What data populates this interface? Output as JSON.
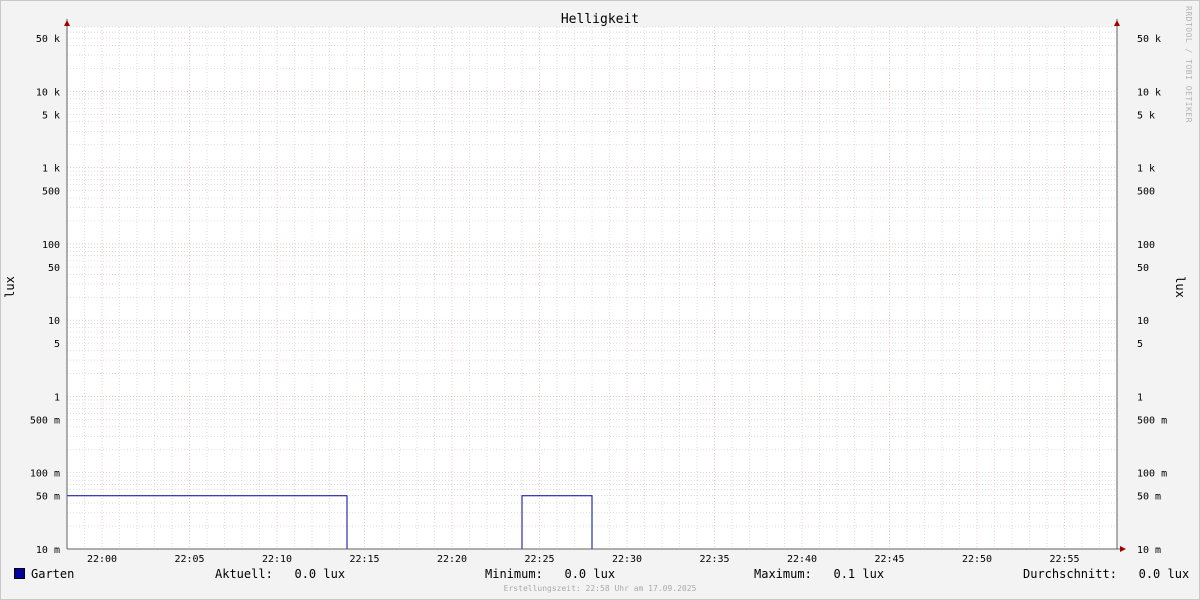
{
  "chart_data": {
    "type": "line",
    "title": "Helligkeit",
    "ylabel_left": "lux",
    "ylabel_right": "lux",
    "y_scale": "log",
    "ylim": [
      0.01,
      70000
    ],
    "y_ticks": [
      {
        "value": 0.01,
        "label": "10 m"
      },
      {
        "value": 0.05,
        "label": "50 m"
      },
      {
        "value": 0.1,
        "label": "100 m"
      },
      {
        "value": 0.5,
        "label": "500 m"
      },
      {
        "value": 1,
        "label": "1"
      },
      {
        "value": 5,
        "label": "5"
      },
      {
        "value": 10,
        "label": "10"
      },
      {
        "value": 50,
        "label": "50"
      },
      {
        "value": 100,
        "label": "100"
      },
      {
        "value": 500,
        "label": "500"
      },
      {
        "value": 1000,
        "label": "1 k"
      },
      {
        "value": 5000,
        "label": "5 k"
      },
      {
        "value": 10000,
        "label": "10 k"
      },
      {
        "value": 50000,
        "label": "50 k"
      }
    ],
    "x_ticks": [
      "22:00",
      "22:05",
      "22:10",
      "22:15",
      "22:20",
      "22:25",
      "22:30",
      "22:35",
      "22:40",
      "22:45",
      "22:50",
      "22:55"
    ],
    "xlim": [
      "21:58",
      "22:58"
    ],
    "grid": true,
    "series": [
      {
        "name": "Garten",
        "color": "#0000a0",
        "points": [
          [
            "21:58",
            0.05
          ],
          [
            "22:14",
            0.05
          ],
          [
            "22:14",
            0.01
          ],
          [
            "22:24",
            0.01
          ],
          [
            "22:24",
            0.05
          ],
          [
            "22:28",
            0.05
          ],
          [
            "22:28",
            0.01
          ],
          [
            "22:58",
            0.01
          ]
        ]
      }
    ]
  },
  "legend": {
    "series_name": "Garten",
    "current": "Aktuell:   0.0 lux",
    "minimum": "Minimum:   0.0 lux",
    "maximum": "Maximum:   0.1 lux",
    "average": "Durchschnitt:   0.0 lux"
  },
  "footer": "Erstellungszeit: 22:58 Uhr am 17.09.2025",
  "watermark": "RRDTOOL / TOBI OETIKER",
  "colors": {
    "canvas": "#ffffff",
    "major_grid": "#e8a0a8",
    "minor_grid": "#c8c8c8",
    "axis": "#606060",
    "arrow": "#a00000",
    "series": "#0000a0"
  }
}
